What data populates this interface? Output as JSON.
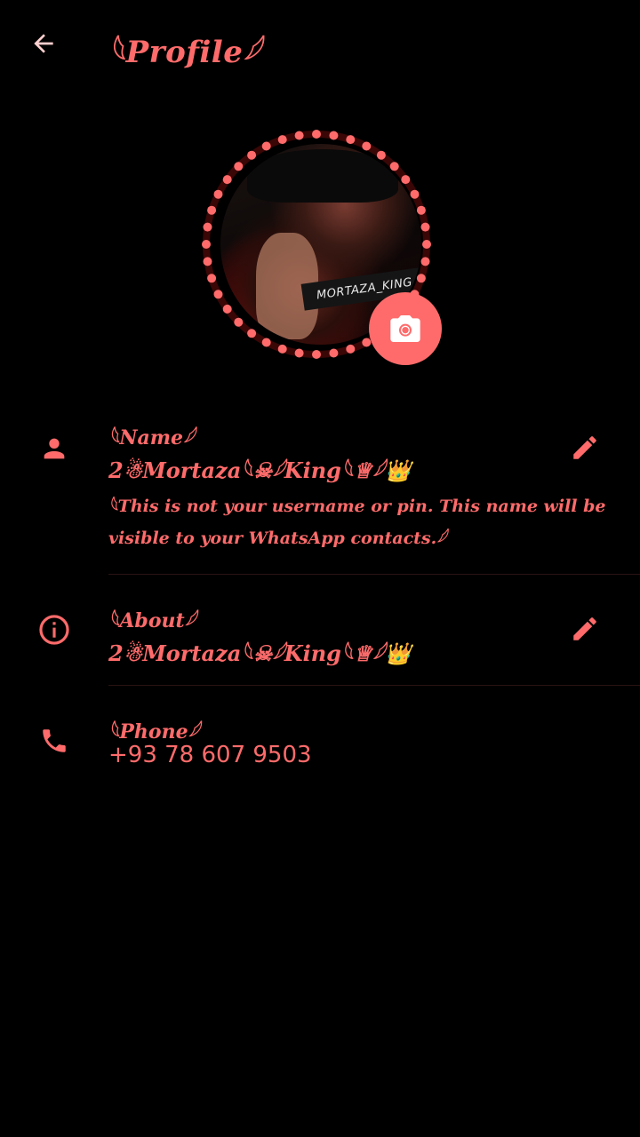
{
  "header": {
    "title": "𓆩Profile𓆪"
  },
  "avatar": {
    "photo_caption": "MORTAZA_KING"
  },
  "name_row": {
    "label": "𓆩Name𓆪",
    "value": "2☃Mortaza𓆩☠𓆪King𓆩♕𓆪👑",
    "hint": "𓆩This is not your username or pin. This name will be visible to your WhatsApp contacts.𓆪"
  },
  "about_row": {
    "label": "𓆩About𓆪",
    "value": "2☃Mortaza𓆩☠𓆪King𓆩♕𓆪👑"
  },
  "phone_row": {
    "label": "𓆩Phone𓆪",
    "value": "+93 78 607 9503"
  },
  "colors": {
    "background": "#000000",
    "accent": "#ff6b6b"
  },
  "icons": {
    "back": "arrow-left-icon",
    "camera": "camera-icon",
    "person": "person-icon",
    "info": "info-icon",
    "phone": "phone-icon",
    "edit": "pencil-icon"
  }
}
